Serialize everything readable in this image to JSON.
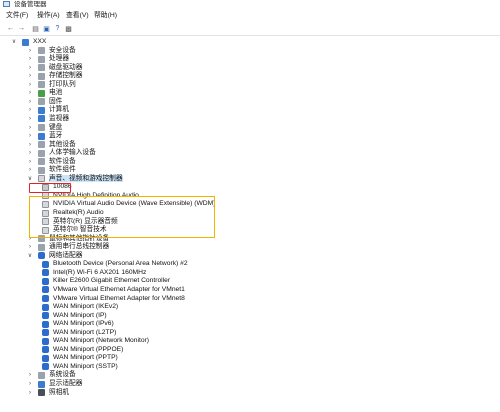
{
  "window": {
    "title": "设备管理器"
  },
  "menu": [
    {
      "label": "文件(F)"
    },
    {
      "label": "操作(A)"
    },
    {
      "label": "查看(V)"
    },
    {
      "label": "帮助(H)"
    }
  ],
  "toolbar": {
    "buttons": [
      "back-icon",
      "forward-icon",
      "properties-icon",
      "help-icon",
      "update-icon",
      "scan-icon"
    ]
  },
  "tree": {
    "root": {
      "label": "XXX"
    },
    "categories_top": [
      {
        "label": "安全设备",
        "icon": "gray"
      },
      {
        "label": "处理器",
        "icon": "gray"
      },
      {
        "label": "磁盘驱动器",
        "icon": "gray"
      },
      {
        "label": "存储控制器",
        "icon": "gray"
      },
      {
        "label": "打印队列",
        "icon": "gray"
      },
      {
        "label": "电池",
        "icon": "green"
      },
      {
        "label": "固件",
        "icon": "gray"
      },
      {
        "label": "计算机",
        "icon": "blue"
      },
      {
        "label": "监视器",
        "icon": "blue"
      },
      {
        "label": "键盘",
        "icon": "gray"
      },
      {
        "label": "蓝牙",
        "icon": "blue"
      },
      {
        "label": "其他设备",
        "icon": "gray"
      },
      {
        "label": "人体学输入设备",
        "icon": "gray"
      },
      {
        "label": "软件设备",
        "icon": "gray"
      },
      {
        "label": "软件组件",
        "icon": "gray"
      }
    ],
    "audio_category": {
      "label": "声音、视频和游戏控制器"
    },
    "audio_children": [
      {
        "label": "10086"
      },
      {
        "label": "NVIDIA High Definition Audio"
      },
      {
        "label": "NVIDIA Virtual Audio Device (Wave Extensible) (WDM)"
      },
      {
        "label": "Realtek(R) Audio"
      },
      {
        "label": "英特尔(R) 显示器音频"
      },
      {
        "label": "英特尔® 智音技术"
      }
    ],
    "categories_mid": [
      {
        "label": "鼠标和其他指针设备",
        "icon": "gray"
      },
      {
        "label": "通用串行总线控制器",
        "icon": "gray"
      }
    ],
    "network_category": {
      "label": "网络适配器"
    },
    "network_children": [
      {
        "label": "Bluetooth Device (Personal Area Network) #2"
      },
      {
        "label": "Intel(R) Wi-Fi 6 AX201 160MHz"
      },
      {
        "label": "Killer E2600 Gigabit Ethernet Controller"
      },
      {
        "label": "VMware Virtual Ethernet Adapter for VMnet1"
      },
      {
        "label": "VMware Virtual Ethernet Adapter for VMnet8"
      },
      {
        "label": "WAN Miniport (IKEv2)"
      },
      {
        "label": "WAN Miniport (IP)"
      },
      {
        "label": "WAN Miniport (IPv6)"
      },
      {
        "label": "WAN Miniport (L2TP)"
      },
      {
        "label": "WAN Miniport (Network Monitor)"
      },
      {
        "label": "WAN Miniport (PPPOE)"
      },
      {
        "label": "WAN Miniport (PPTP)"
      },
      {
        "label": "WAN Miniport (SSTP)"
      }
    ],
    "categories_bottom": [
      {
        "label": "系统设备",
        "icon": "gray"
      },
      {
        "label": "显示适配器",
        "icon": "blue"
      },
      {
        "label": "照相机",
        "icon": "dark"
      }
    ]
  }
}
